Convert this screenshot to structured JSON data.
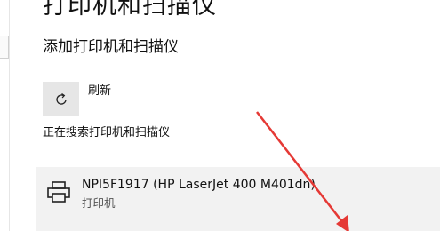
{
  "page": {
    "title": "打印机和扫描仪"
  },
  "section": {
    "add_title": "添加打印机和扫描仪"
  },
  "refresh": {
    "label": "刷新",
    "icon": "refresh-icon"
  },
  "status": {
    "searching": "正在搜索打印机和扫描仪"
  },
  "printers": [
    {
      "name": "NPI5F1917 (HP LaserJet 400 M401dn)",
      "type": "打印机",
      "icon": "printer-icon"
    }
  ],
  "colors": {
    "annotation_arrow": "#e53935",
    "button_bg": "#e6e6e6",
    "row_bg": "#f2f2f2"
  }
}
